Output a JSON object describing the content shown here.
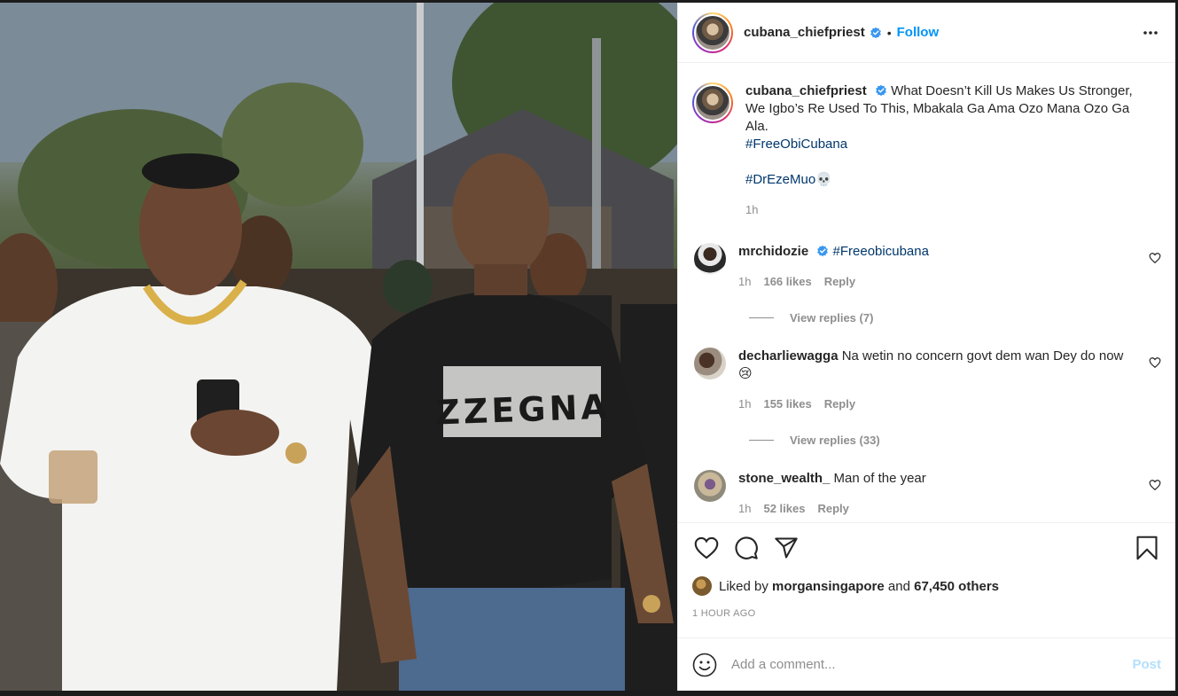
{
  "post": {
    "author": "cubana_chiefpriest",
    "follow_label": "Follow",
    "separator": "•",
    "photo_print_text": "ZZEGNA"
  },
  "caption": {
    "username": "cubana_chiefpriest",
    "text": "What Doesn’t Kill Us Makes Us Stronger, We Igbo’s Re Used To This, Mbakala Ga Ama Ozo Mana Ozo Ga Ala.",
    "hashtag1": "#FreeObiCubana",
    "hashtag2": "#DrEzeMuo",
    "emoji": "💀",
    "time": "1h"
  },
  "comments": [
    {
      "username": "mrchidozie",
      "verified": true,
      "text": "#Freeobicubana",
      "time": "1h",
      "likes": "166 likes",
      "reply_label": "Reply",
      "view_replies": "View replies (7)"
    },
    {
      "username": "decharliewagga",
      "verified": false,
      "text": "Na wetin no concern govt dem wan Dey do now",
      "emoji": "😢",
      "time": "1h",
      "likes": "155 likes",
      "reply_label": "Reply",
      "view_replies": "View replies (33)"
    },
    {
      "username": "stone_wealth_",
      "verified": false,
      "text": "Man of the year",
      "time": "1h",
      "likes": "52 likes",
      "reply_label": "Reply"
    }
  ],
  "likes": {
    "prefix": "Liked by",
    "liker": "morgansingapore",
    "and": "and",
    "others": "67,450 others"
  },
  "timestamp": "1 HOUR AGO",
  "add_comment": {
    "placeholder": "Add a comment...",
    "post_label": "Post"
  },
  "icons": [
    "verified-badge-icon",
    "more-options-icon",
    "heart-icon",
    "comment-icon",
    "share-icon",
    "bookmark-icon",
    "emoji-icon"
  ],
  "colors": {
    "link": "#0095f6",
    "hashtag": "#00376b",
    "muted": "#8e8e8e",
    "post_disabled": "#b2dffc",
    "verified": "#3897f0"
  }
}
